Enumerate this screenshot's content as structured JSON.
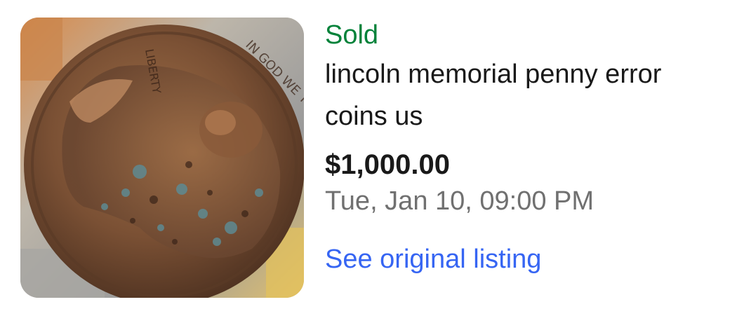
{
  "listing": {
    "status": "Sold",
    "title": "lincoln memorial penny error coins us",
    "price": "$1,000.00",
    "date": "Tue, Jan 10, 09:00 PM",
    "link_label": "See original listing",
    "image": {
      "subject": "coin-photo",
      "coin_lettering_top": "LIBERTY",
      "coin_lettering_right": "IN GOD WE TRUST"
    }
  },
  "colors": {
    "status": "#04823a",
    "text": "#191919",
    "muted": "#707070",
    "link": "#3665f3"
  }
}
